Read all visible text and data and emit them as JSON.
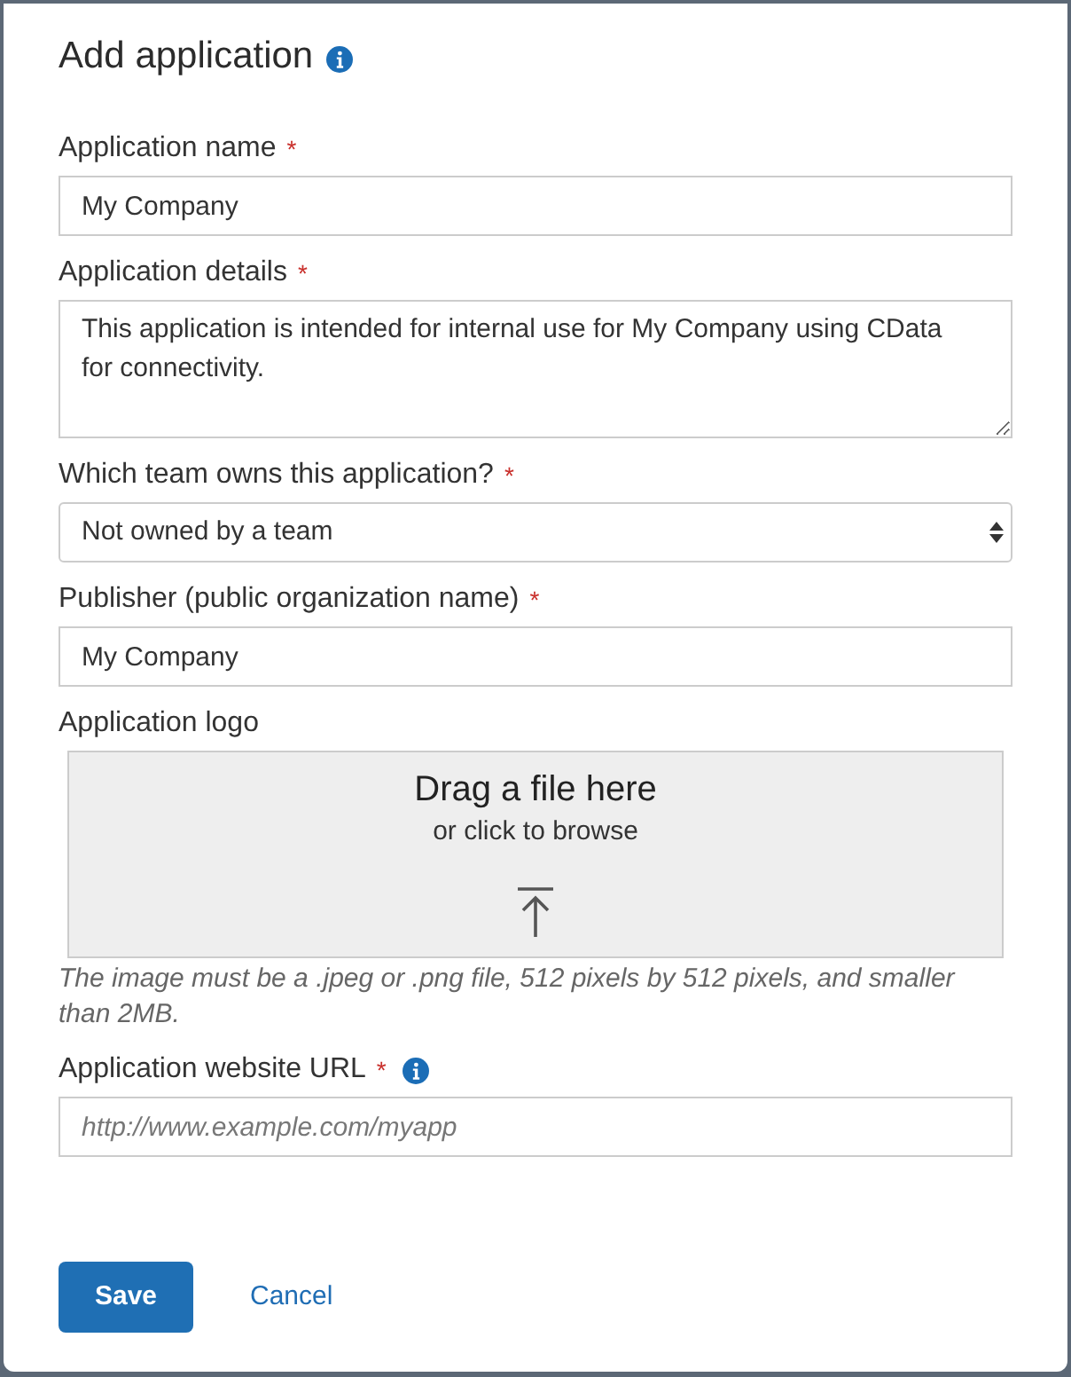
{
  "title": {
    "text": "Add application",
    "info": true
  },
  "fields": [
    {
      "kind": "text",
      "label": "Application name",
      "required_mark": "*",
      "value": "My Company"
    },
    {
      "kind": "textarea",
      "label": "Application details",
      "required_mark": "*",
      "value": "This application is intended for internal use for My Company using CData for connectivity."
    },
    {
      "kind": "select",
      "label": "Which team owns this application?",
      "required_mark": "*",
      "value": "Not owned by a team"
    },
    {
      "kind": "text",
      "label": "Publisher (public organization name)",
      "required_mark": "*",
      "value": "My Company"
    },
    {
      "kind": "dropzone",
      "label": "Application logo",
      "heading": "Drag a file here",
      "subtext": "or click to browse",
      "hint": "The image must be a .jpeg or .png file, 512 pixels by 512 pixels, and smaller than 2MB."
    },
    {
      "kind": "text",
      "label": "Application website URL",
      "required_mark": "*",
      "info": true,
      "placeholder": "http://www.example.com/myapp"
    }
  ],
  "buttons": [
    {
      "kind": "primary",
      "label": "Save"
    },
    {
      "kind": "link",
      "label": "Cancel"
    }
  ]
}
